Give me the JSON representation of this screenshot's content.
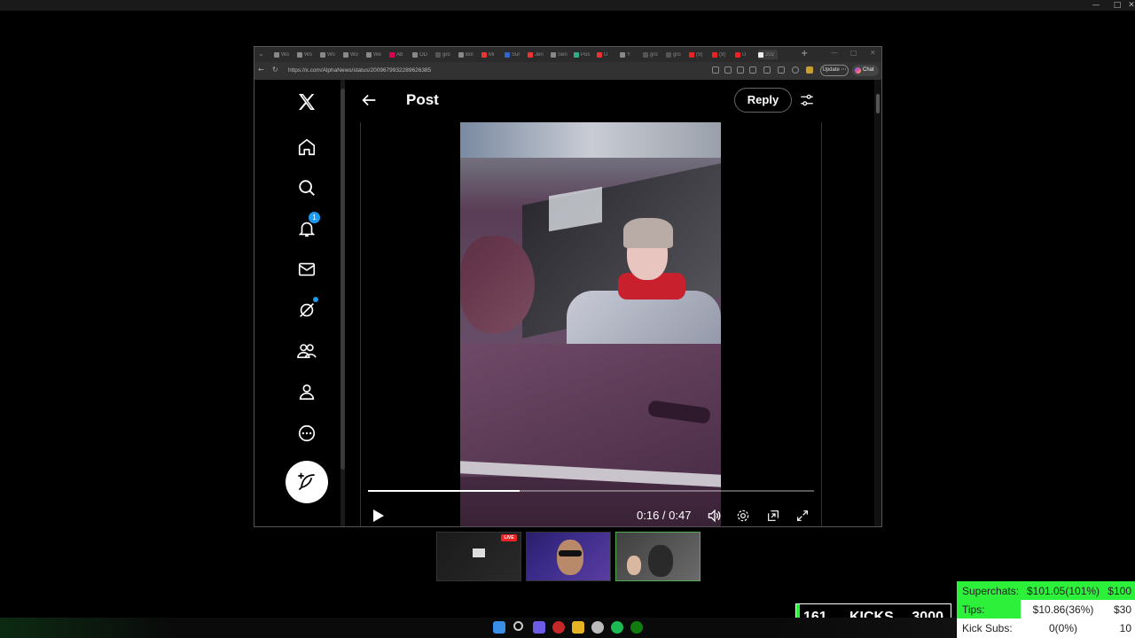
{
  "browser": {
    "url": "https://x.com/AlphaNews/status/2009679932289626385",
    "update_label": "Update",
    "chat_label": "Chat",
    "tabs": [
      {
        "label": "Wo",
        "color": "#888"
      },
      {
        "label": "Wo",
        "color": "#888"
      },
      {
        "label": "Wo",
        "color": "#888"
      },
      {
        "label": "Wo",
        "color": "#888"
      },
      {
        "label": "We",
        "color": "#888"
      },
      {
        "label": "Ab",
        "color": "#d05"
      },
      {
        "label": "OD",
        "color": "#888"
      },
      {
        "label": "gro",
        "color": "#555"
      },
      {
        "label": "Bol",
        "color": "#888"
      },
      {
        "label": "Mi",
        "color": "#e33"
      },
      {
        "label": "Sur",
        "color": "#36c"
      },
      {
        "label": "Jen",
        "color": "#e33"
      },
      {
        "label": "Sen",
        "color": "#888"
      },
      {
        "label": "Pos",
        "color": "#3a8"
      },
      {
        "label": "U",
        "color": "#e33"
      },
      {
        "label": "Y",
        "color": "#888"
      },
      {
        "label": "gro",
        "color": "#555"
      },
      {
        "label": "gro",
        "color": "#555"
      },
      {
        "label": "(9)",
        "color": "#e22"
      },
      {
        "label": "(9)",
        "color": "#e22"
      },
      {
        "label": "U",
        "color": "#e22"
      },
      {
        "label": "202",
        "color": "#eee"
      }
    ]
  },
  "x": {
    "nav": [
      {
        "name": "home",
        "icon": "home-icon"
      },
      {
        "name": "explore",
        "icon": "search-icon"
      },
      {
        "name": "notifications",
        "icon": "bell-icon",
        "badge": "1"
      },
      {
        "name": "messages",
        "icon": "mail-icon"
      },
      {
        "name": "grok",
        "icon": "grok-icon"
      },
      {
        "name": "communities",
        "icon": "people-icon"
      },
      {
        "name": "profile",
        "icon": "person-icon"
      },
      {
        "name": "more",
        "icon": "more-icon"
      }
    ],
    "header_title": "Post",
    "reply_label": "Reply",
    "video": {
      "current_time": "0:16",
      "duration": "0:47",
      "time_display": "0:16 / 0:47",
      "progress": 0.34
    }
  },
  "overlay": {
    "live_label": "LIVE",
    "kicks": {
      "value": "161",
      "label": "KICKS",
      "goal": "3000"
    },
    "donations": [
      {
        "label": "Superchats:",
        "amount": "$101.05(101%)",
        "goal": "$100",
        "fill": 1.0
      },
      {
        "label": "Tips:",
        "amount": "$10.86(36%)",
        "goal": "$30",
        "fill": 0.36
      },
      {
        "label": "Kick Subs:",
        "amount": "0(0%)",
        "goal": "10",
        "fill": 0.0
      }
    ]
  },
  "colors": {
    "accent": "#1d9bf0",
    "goal_green": "#2cf03a",
    "live_red": "#ee2222"
  }
}
